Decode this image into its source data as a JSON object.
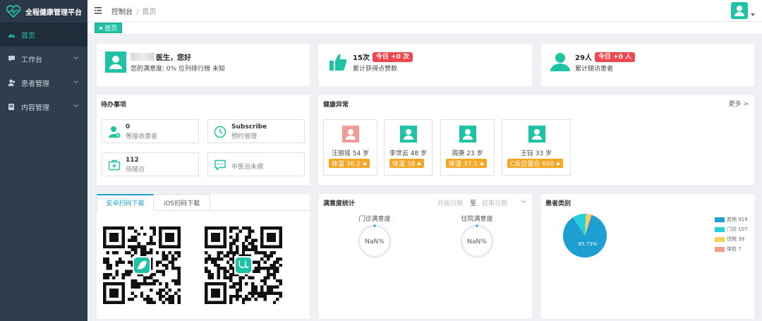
{
  "brand": {
    "title": "全程健康管理平台"
  },
  "sidebar": {
    "items": [
      {
        "label": "首页",
        "icon": "dashboard-icon",
        "active": true
      },
      {
        "label": "工作台",
        "icon": "chat-icon",
        "expandable": true
      },
      {
        "label": "患者管理",
        "icon": "user-icon",
        "expandable": true
      },
      {
        "label": "内容管理",
        "icon": "document-icon",
        "expandable": true
      }
    ]
  },
  "topbar": {
    "breadcrumb_root": "控制台",
    "breadcrumb_sep": "/",
    "breadcrumb_current": "首页"
  },
  "tags": [
    {
      "label": "首页"
    }
  ],
  "stats": {
    "doctor": {
      "greeting": "医生，您好",
      "subtitle": "您的满意度: 0% 位列排行榜 未知"
    },
    "likes": {
      "count": "15次",
      "today": "今日 +0 次",
      "subtitle": "累计获得点赞数"
    },
    "followups": {
      "count": "29人",
      "today": "今日 +0 人",
      "subtitle": "累计随访患者"
    }
  },
  "todo": {
    "title": "待办事项",
    "items": [
      {
        "value": "0",
        "label": "等接收患者",
        "icon": "user-add-icon"
      },
      {
        "value": "Subscribe",
        "label": "预约管理",
        "icon": "clock-icon"
      },
      {
        "value": "112",
        "label": "待随访",
        "icon": "medical-kit-icon"
      },
      {
        "value": "",
        "label": "中医治未病",
        "icon": "message-icon"
      }
    ]
  },
  "health": {
    "title": "健康异常",
    "more": "更多 >",
    "patients": [
      {
        "name": "汪丽瑶 54 岁",
        "badge": "体温 36.2",
        "avatar_color": "#f29c96"
      },
      {
        "name": "李世云 48 岁",
        "badge": "体温 38",
        "avatar_color": "#1ec2a4"
      },
      {
        "name": "周庚 23 岁",
        "badge": "体温 37.1",
        "avatar_color": "#1ec2a4"
      },
      {
        "name": "王钰 33 岁",
        "badge": "C反应蛋白 600",
        "avatar_color": "#1ec2a4"
      }
    ]
  },
  "download": {
    "tabs": [
      {
        "label": "安卓扫码下载",
        "active": true
      },
      {
        "label": "iOS扫码下载",
        "active": false
      }
    ]
  },
  "satisfaction": {
    "title": "满意度统计",
    "start_placeholder": "开始日期",
    "to": "至",
    "end_placeholder": "结束日期",
    "gauges": [
      {
        "title": "门诊满意度",
        "value": "NaN%"
      },
      {
        "title": "住院满意度",
        "value": "NaN%"
      }
    ]
  },
  "patient_types": {
    "title": "患者类别",
    "center_label": "85.73%",
    "colors": {
      "其他": "#1e9fd1",
      "门诊": "#26cfd9",
      "住院": "#f5cd57",
      "体检": "#f79b86"
    }
  },
  "chart_data": {
    "type": "pie",
    "title": "患者类别",
    "categories": [
      "其他",
      "门诊",
      "住院",
      "体检"
    ],
    "values": [
      919,
      107,
      39,
      7
    ],
    "legend_labels": [
      "其他 919",
      "门诊 107",
      "住院 39",
      "体检 7"
    ],
    "legend_position": "right",
    "data_labels": [
      "85.73%"
    ]
  }
}
